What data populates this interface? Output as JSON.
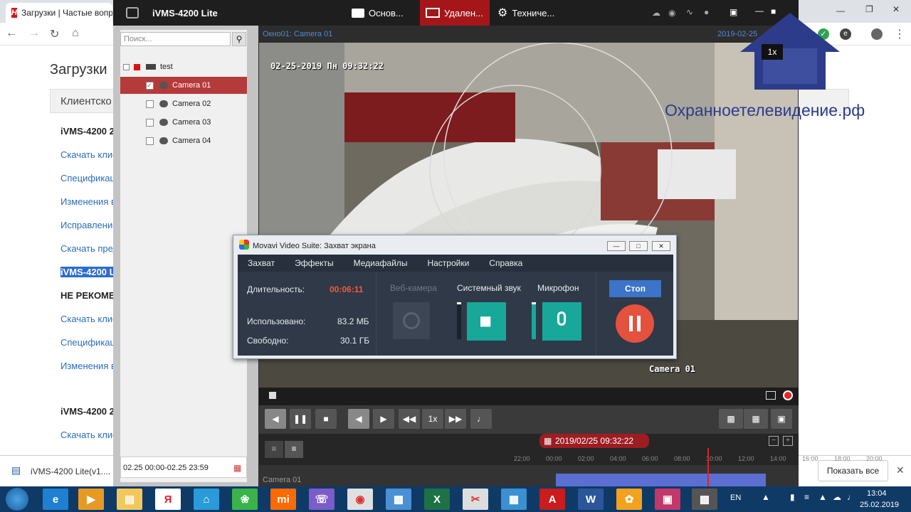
{
  "browser": {
    "tab_title": "Загрузки | Частые вопр",
    "page_heading": "Загрузки",
    "client_button": "Клиентско",
    "left_items": [
      {
        "text": "iVMS-4200 2",
        "kind": "bold"
      },
      {
        "text": "Скачать клие",
        "kind": "link"
      },
      {
        "text": "Спецификац",
        "kind": "link"
      },
      {
        "text": "Изменения в",
        "kind": "link"
      },
      {
        "text": "Исправление",
        "kind": "link"
      },
      {
        "text": "Скачать пред",
        "kind": "link"
      },
      {
        "text": "iVMS-4200 L",
        "kind": "selected"
      },
      {
        "text": "НЕ РЕКОМЕН",
        "kind": "bold"
      },
      {
        "text": "Скачать клие",
        "kind": "link"
      },
      {
        "text": "Спецификац",
        "kind": "link"
      },
      {
        "text": "Изменения в",
        "kind": "link"
      }
    ],
    "left_items_2": [
      {
        "text": "iVMS-4200 2",
        "kind": "bold"
      },
      {
        "text": "Скачать клие",
        "kind": "link"
      }
    ],
    "download_file": "iVMS-4200 Lite(v1....",
    "show_all": "Показать все"
  },
  "ivms": {
    "app_title": "iVMS-4200 Lite",
    "tabs": [
      "Основ...",
      "Удален...",
      "Техниче..."
    ],
    "search_placeholder": "Поиск...",
    "tree_root": "test",
    "cameras": [
      "Camera 01",
      "Camera 02",
      "Camera 03",
      "Camera 04"
    ],
    "date_range": "02.25 00:00-02.25 23:59",
    "video_window": "Окно01:  Camera 01",
    "video_date": "2019-02-25",
    "osd_timestamp": "02-25-2019 Пн 09:32:22",
    "osd_camera": "Camera 01",
    "speed": "1x",
    "timeline_time": "2019/02/25 09:32:22",
    "timeline_ticks": [
      "22:00",
      "00:00",
      "02:00",
      "04:00",
      "06:00",
      "08:00",
      "10:00",
      "12:00",
      "14:00",
      "16:00",
      "18:00",
      "20:00"
    ],
    "timeline_camera": "Camera 01"
  },
  "movavi": {
    "title": "Movavi Video Suite: Захват экрана",
    "menu": [
      "Захват",
      "Эффекты",
      "Медиафайлы",
      "Настройки",
      "Справка"
    ],
    "duration_label": "Длительность:",
    "duration_value": "00:06:11",
    "used_label": "Использовано:",
    "used_value": "83.2 МБ",
    "free_label": "Свободно:",
    "free_value": "30.1 ГБ",
    "webcam_label": "Веб-камера",
    "sysaudio_label": "Системный звук",
    "mic_label": "Микрофон",
    "stop_label": "Стоп"
  },
  "overlay": {
    "badge": "1x",
    "site": "Охранноетелевидение.рф"
  },
  "taskbar": {
    "lang": "EN",
    "time": "13:04",
    "date": "25.02.2019"
  },
  "colors": {
    "accent_red": "#e44d3a",
    "teal": "#12a89a",
    "selected_camera_bg": "#b53a3a",
    "overlay_blue": "#2d3c8a"
  }
}
